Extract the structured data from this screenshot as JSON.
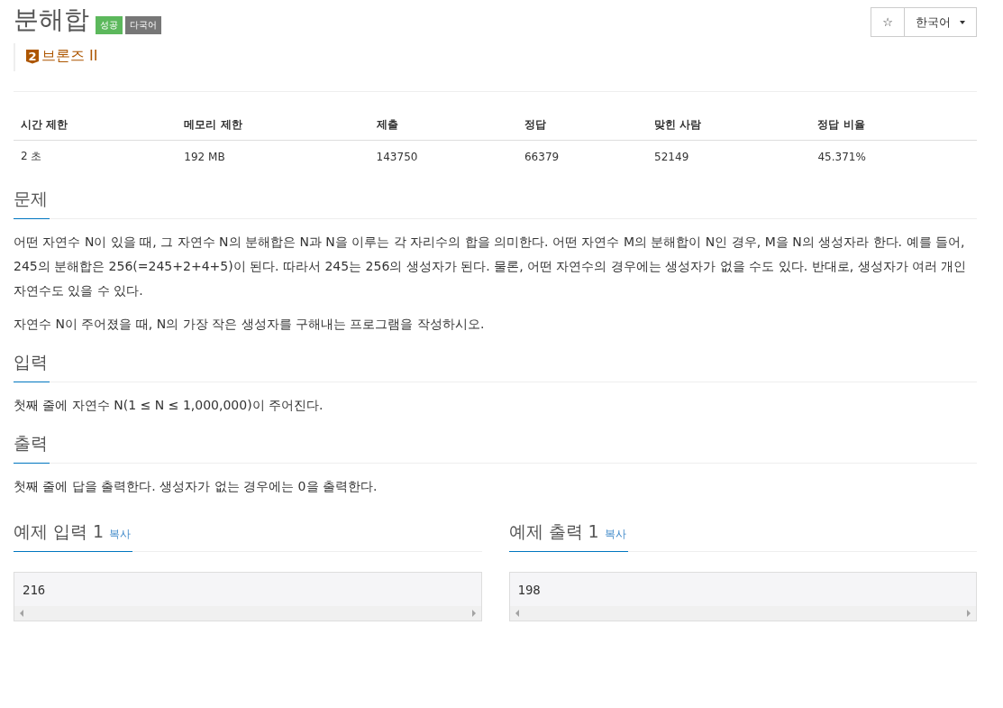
{
  "problem": {
    "title": "분해합",
    "badges": [
      {
        "label": "성공",
        "color": "#5cb85c"
      },
      {
        "label": "다국어",
        "color": "#777777"
      }
    ],
    "tier": {
      "number": "2",
      "label": "브론즈 II"
    }
  },
  "header_actions": {
    "star": "☆",
    "language": "한국어"
  },
  "stats": {
    "columns": [
      "시간 제한",
      "메모리 제한",
      "제출",
      "정답",
      "맞힌 사람",
      "정답 비율"
    ],
    "rows": [
      [
        "2 초",
        "192 MB",
        "143750",
        "66379",
        "52149",
        "45.371%"
      ]
    ]
  },
  "sections": [
    {
      "title": "문제",
      "paragraphs": [
        "어떤 자연수 N이 있을 때, 그 자연수 N의 분해합은 N과 N을 이루는 각 자리수의 합을 의미한다. 어떤 자연수 M의 분해합이 N인 경우, M을 N의 생성자라 한다. 예를 들어, 245의 분해합은 256(=245+2+4+5)이 된다. 따라서 245는 256의 생성자가 된다. 물론, 어떤 자연수의 경우에는 생성자가 없을 수도 있다. 반대로, 생성자가 여러 개인 자연수도 있을 수 있다.",
        "자연수 N이 주어졌을 때, N의 가장 작은 생성자를 구해내는 프로그램을 작성하시오."
      ]
    },
    {
      "title": "입력",
      "paragraphs": [
        "첫째 줄에 자연수 N(1 ≤ N ≤ 1,000,000)이 주어진다."
      ]
    },
    {
      "title": "출력",
      "paragraphs": [
        "첫째 줄에 답을 출력한다. 생성자가 없는 경우에는 0을 출력한다."
      ]
    }
  ],
  "samples": [
    {
      "title": "예제 입력 1",
      "copy": "복사",
      "content": "216"
    },
    {
      "title": "예제 출력 1",
      "copy": "복사",
      "content": "198"
    }
  ]
}
